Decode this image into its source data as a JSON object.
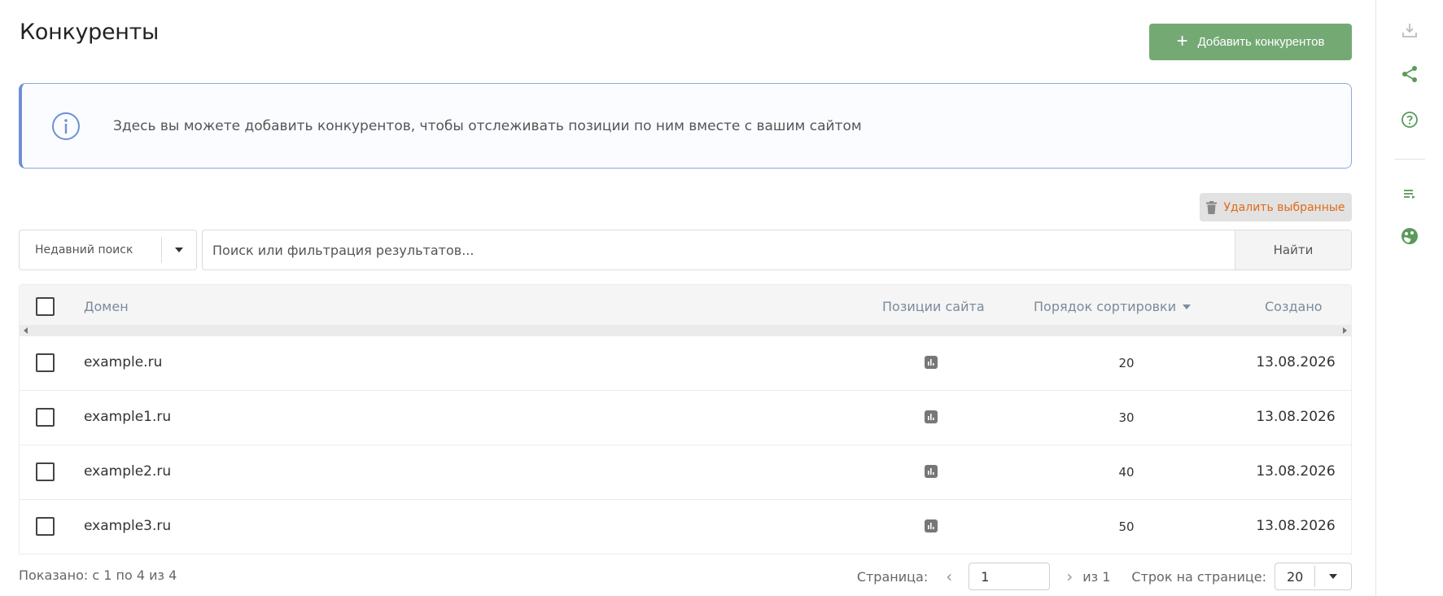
{
  "header": {
    "title": "Конкуренты",
    "add_button_label": "Добавить конкурентов"
  },
  "info": {
    "text": "Здесь вы можете добавить конкурентов, чтобы отслеживать позиции по ним вместе с вашим сайтом",
    "icon": "info-circle-icon"
  },
  "toolbar": {
    "delete_selected_label": "Удалить выбранные",
    "recent_search_label": "Недавний поиск",
    "search_placeholder": "Поиск или фильтрация результатов...",
    "search_button_label": "Найти"
  },
  "table": {
    "columns": {
      "domain": "Домен",
      "positions": "Позиции сайта",
      "order": "Порядок сортировки",
      "created": "Создано"
    },
    "rows": [
      {
        "domain": "example.ru",
        "order": "20",
        "created": "13.08.2026"
      },
      {
        "domain": "example1.ru",
        "order": "30",
        "created": "13.08.2026"
      },
      {
        "domain": "example2.ru",
        "order": "40",
        "created": "13.08.2026"
      },
      {
        "domain": "example3.ru",
        "order": "50",
        "created": "13.08.2026"
      }
    ]
  },
  "footer": {
    "shown_text": "Показано: с 1 по 4 из 4",
    "page_label": "Страница:",
    "page_value": "1",
    "of_text": "из 1",
    "rows_per_page_label": "Строк на странице:",
    "rows_per_page_value": "20"
  },
  "colors": {
    "accent_green": "#74a974",
    "info_border": "#6f8fd5",
    "delete_text": "#e06a1a"
  },
  "rail_icons": [
    "download-icon",
    "share-icon",
    "help-icon",
    "playlist-icon",
    "palette-icon"
  ]
}
